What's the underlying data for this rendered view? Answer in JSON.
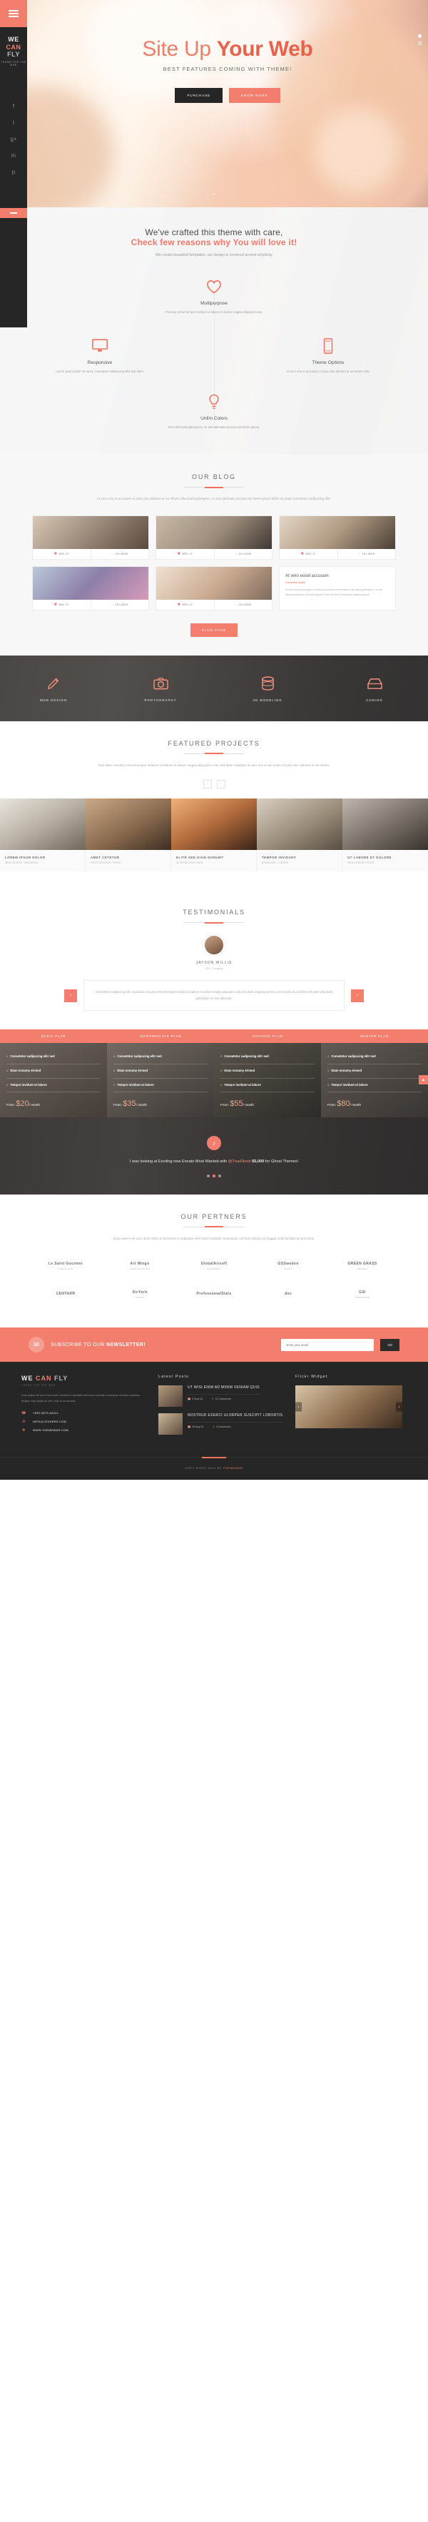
{
  "brand": {
    "line1": "WE",
    "line2": "CAN",
    "line3": "FLY",
    "tagline": "THEME FOR THE WEB"
  },
  "rail": {
    "socials": [
      "f",
      "t",
      "g+",
      "in",
      "p"
    ]
  },
  "hero": {
    "title_1": "Site Up ",
    "title_2": "Your Web",
    "subtitle": "BEST FEATURES COMING WITH THEME!",
    "btn_purchase": "PURCHASE",
    "btn_know": "KNOW MORE",
    "scroll_icon": "chevron-down"
  },
  "features": {
    "heading_1": "We've crafted this theme with care,",
    "heading_2": "Check few reasons why You will love it!",
    "lede": "We create beautifull templates, our design is centered around simplicity",
    "items": [
      {
        "icon": "heart-icon",
        "title": "Multipurpose",
        "desc": "Ponumy emod tempor invidunt ut labore\net dolore magna aliquyam erat."
      },
      {
        "icon": "monitor-icon",
        "title": "Responsive",
        "desc": "Lorem ipsum dolor sit amet, consetetur\nsadipscing elitr sed diam."
      },
      {
        "icon": "mobile-icon",
        "title": "Theme Options",
        "desc": "At vero eos et accusam et justo duo\ndolores et ea rebum cilta."
      },
      {
        "icon": "bulb-icon",
        "title": "Unlim Colors",
        "desc": "Stet clita kasd gubergren, no sea takimata\nsanctus est lorem ipsum."
      }
    ]
  },
  "blog": {
    "title": "OUR BLOG",
    "lede": "At vero eos et accusam et justo duo dolores et ea rebum clita kasd gubergren, no sea takimata sanctus est lorem ipsum dolor sit amet consetetur sadipscing elitr.",
    "card_date": "DEC 17",
    "card_likes": "15 LIKES",
    "feature_post": {
      "title": "At vero eosel accusam",
      "by": "consetetur adipisi",
      "excerpt": "At vero eos et accusam et justo duo dolores et ea rebum clita kasd gubergren, no sea takimata sanctus est lorem ipsum dolor sit amet consetetur sadipscing elitr."
    },
    "button": "BLOG PAGE"
  },
  "services": [
    {
      "icon": "pencil-icon",
      "label": "WEB DESIGN"
    },
    {
      "icon": "camera-icon",
      "label": "PHOTOGRAPHY"
    },
    {
      "icon": "cylinder-icon",
      "label": "3D MODELING"
    },
    {
      "icon": "box-icon",
      "label": "CODING"
    }
  ],
  "projects": {
    "title": "FEATURED PROJECTS",
    "lede": "Sed diam nonumy eirmod tempor invidunt ut labore et dolore magna aliquyam erat, sed diam voluptua at vero eos et accusam et justo duo dolores et ea rebum.",
    "prev": "‹",
    "next": "›",
    "items": [
      {
        "title": "LOREM IPSUM DOLOR",
        "cat": "WEB DESIGN / BRANDING"
      },
      {
        "title": "AMET CETETUR",
        "cat": "PHOTOGRAPHY / PRINT"
      },
      {
        "title": "ELITR SED DIAM NONUMY",
        "cat": "3D MODELING / WEB"
      },
      {
        "title": "TEMPOR INVIDUNT",
        "cat": "BRANDING / CODING"
      },
      {
        "title": "UT LABORE ET DOLORE",
        "cat": "WEB DESIGN / PRINT"
      }
    ]
  },
  "testimonials": {
    "title": "TESTIMONIALS",
    "name": "JAYSON WILLIS",
    "role": "CEO, Company",
    "prev": "‹",
    "next": "›",
    "quote": "Consetetur sadipscing elitr, sed diam nonumy eirmod tempor invidunt ut labore et dolore magna aliquyam erat sed diam voluptua at vero eos et justo duo dolores sit amet clita kasd gubergren no sea takimata."
  },
  "pricing": [
    {
      "name": "BASIC PLAN",
      "price": "$20",
      "per": "/ month",
      "from": "From:",
      "features": [
        "Consetetur sadipscing elitr sed",
        "Diam nonumy eirmod",
        "Tempor invidunt ut labore"
      ]
    },
    {
      "name": "INTERMEDIATE PLAN",
      "price": "$35",
      "per": "/ month",
      "from": "From:",
      "features": [
        "Consetetur sadipscing elitr sed",
        "Diam nonumy eirmod",
        "Tempor invidunt ut labore"
      ]
    },
    {
      "name": "ADVANCE PLAN",
      "price": "$55",
      "per": "/ month",
      "from": "From:",
      "features": [
        "Consetetur sadipscing elitr sed",
        "Diam nonumy eirmod",
        "Tempor invidunt ut labore"
      ]
    },
    {
      "name": "MASTER PLAN",
      "price": "$80",
      "per": "/ month",
      "from": "From:",
      "features": [
        "Consetetur sadipscing elitr sed",
        "Diam nonumy eirmod",
        "Tempor invidunt ut labore"
      ]
    }
  ],
  "twitter": {
    "icon": "twitter-icon",
    "line1_a": "I was looking at Exciting new Envato Most Wanted with ",
    "handle": "@TrueGhost",
    "line2": "for Ghost Themes!",
    "amount": "$5,000"
  },
  "partners": {
    "title": "OUR PERTNERS",
    "lede": "Duis autem vel eum iriure dolor in hendrerit in vulputate velit esse molestie consequat, vel illum dolore eu feugiat nulla facilisis at vero eros.",
    "logos": [
      {
        "name": "Le Saint Gourmet",
        "sub": "FINE FOODS"
      },
      {
        "name": "Art Mingo",
        "sub": "CREATIVE STUDIO"
      },
      {
        "name": "GlobalAirsoft",
        "sub": "EQUIPMENT"
      },
      {
        "name": "GSSweden",
        "sub": "GROUP"
      },
      {
        "name": "GREEN GRASS",
        "sub": "ORGANIC"
      },
      {
        "name": "CENTARR",
        "sub": ""
      },
      {
        "name": "SicYork",
        "sub": "STUDIO"
      },
      {
        "name": "ProfessionalStats",
        "sub": ""
      },
      {
        "name": "doc",
        "sub": ""
      },
      {
        "name": "GSI",
        "sub": "WORLDWIDE"
      }
    ]
  },
  "newsletter": {
    "icon": "envelope-icon",
    "title_1": "SUBSCRIBE TO OUR ",
    "title_2": "NEWSLETTER!",
    "placeholder": "Enter your email",
    "button": "GO"
  },
  "footer": {
    "about_title": "WE CAN FLY",
    "about_text": "Duis autem vel eum iriure dolor hendrerit vulputate velit esse molestie consequat vel illum doloreeu feugiat nulla facilisi at vero eros et accumsan.",
    "contacts": [
      {
        "icon": "phone-icon",
        "text": "+555-9876-54321"
      },
      {
        "icon": "mail-icon",
        "text": "INFO@LEADERS.COM"
      },
      {
        "icon": "globe-icon",
        "text": "WWW.THEMEWAR.COM"
      }
    ],
    "latest_title": "Latest Posts",
    "posts": [
      {
        "title": "UT WISI ENIM AD MINIM VENIAM QUIS",
        "date": "3 Sept'14",
        "comments": "11 Comments"
      },
      {
        "title": "NOSTRUD EXERCI ULORPER SUSCIPIT LOBORTIS",
        "date": "29 Aug'14",
        "comments": "9 Comments"
      }
    ],
    "flickr_title": "Flickr Widget",
    "flickr_prev": "‹",
    "flickr_next": "›",
    "copyright_a": "COPY RIGHT 2014 BY ",
    "copyright_b": "THEMEWAR"
  },
  "totop": "▲",
  "colors": {
    "accent": "#f37e6d",
    "dark": "#262626",
    "accent2": "#f0705c"
  }
}
